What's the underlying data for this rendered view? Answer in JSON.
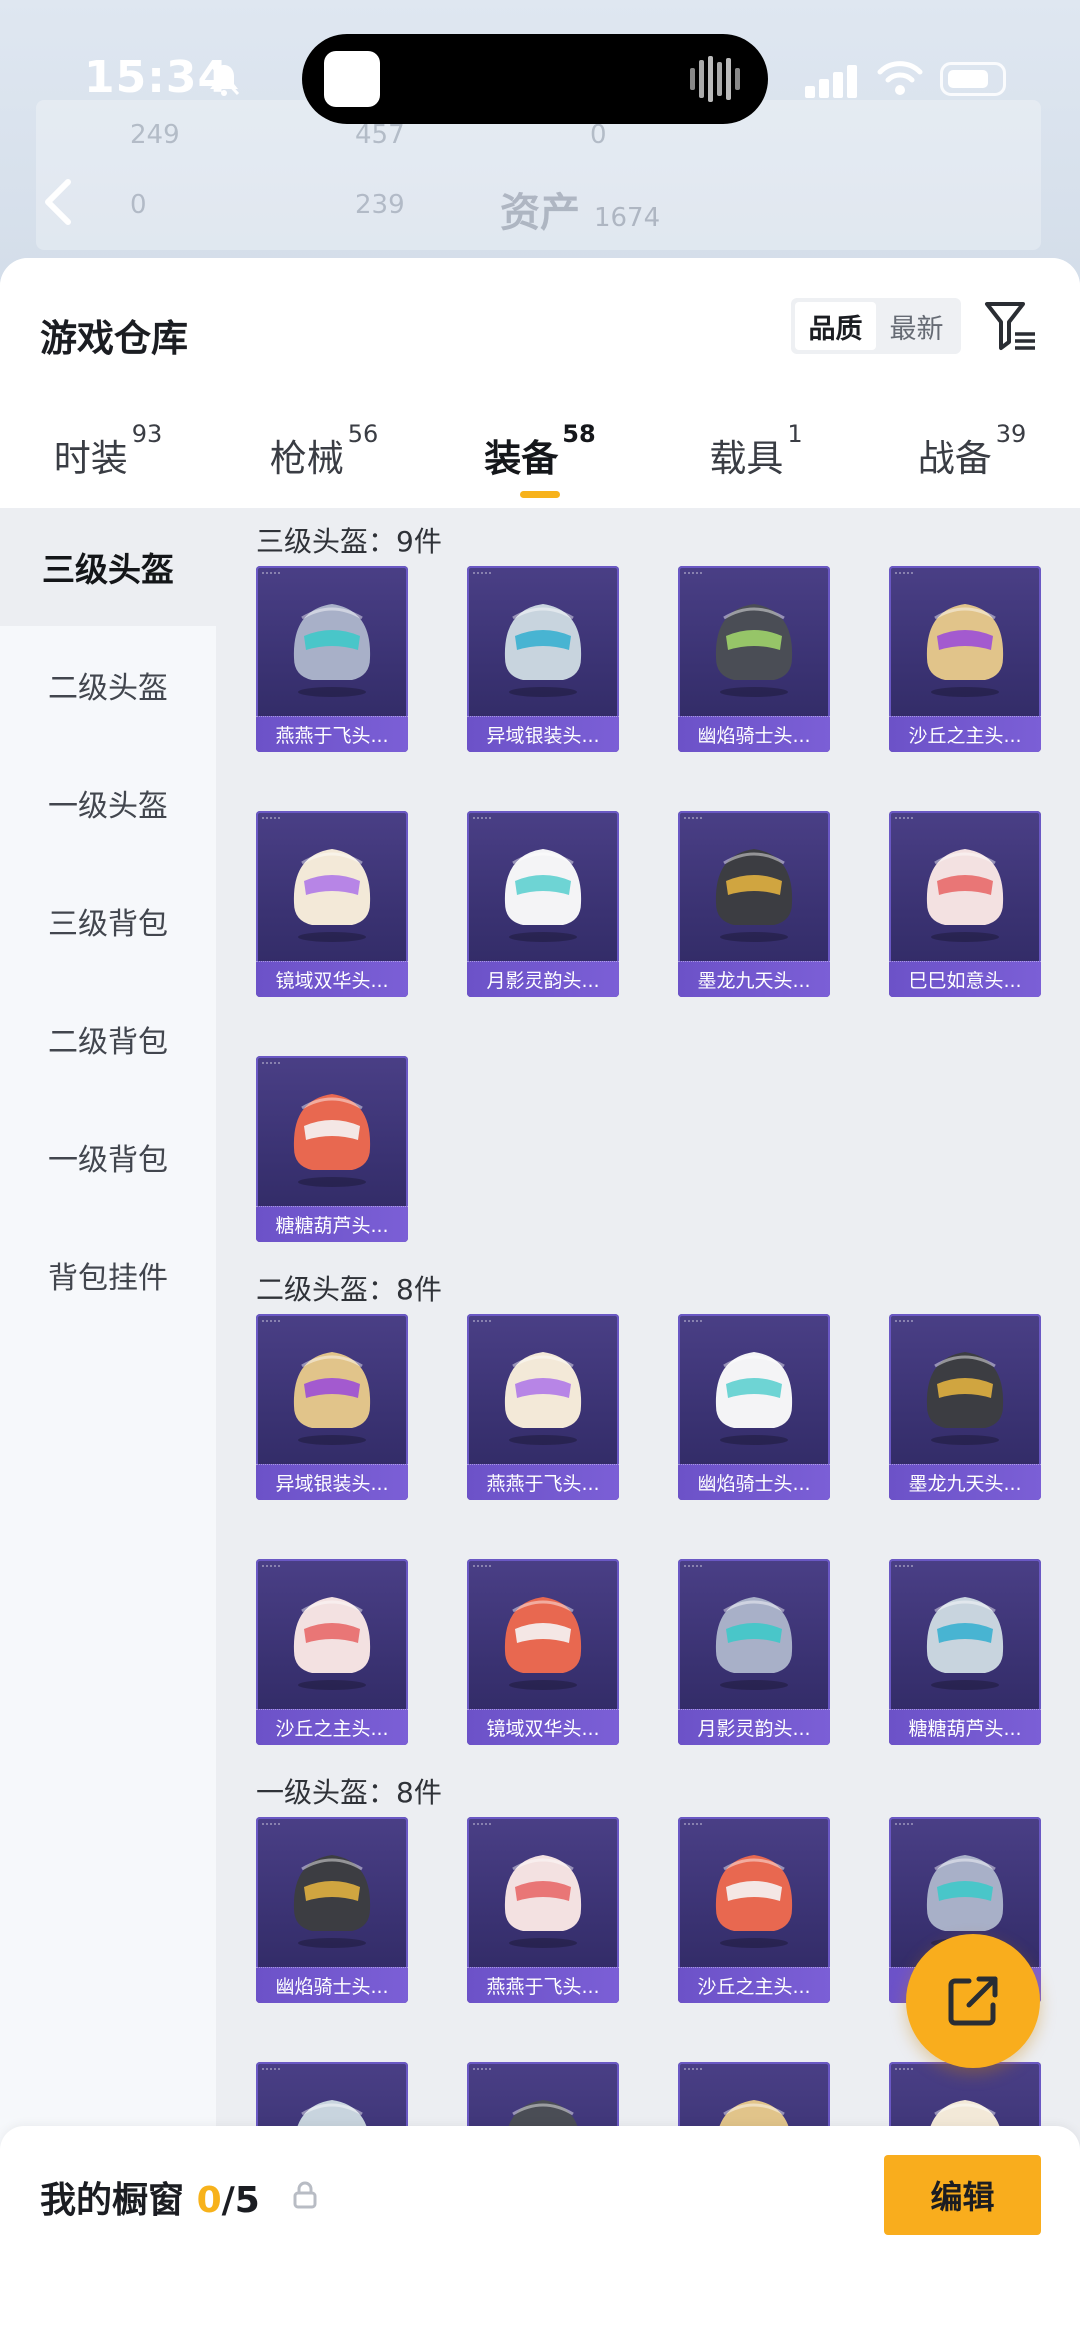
{
  "status_bar": {
    "time": "15:34"
  },
  "backdrop": {
    "nums": [
      "249",
      "457",
      "0",
      "0",
      "239",
      "1674"
    ],
    "asset_label": "资产"
  },
  "header": {
    "title": "游戏仓库",
    "sort_options": [
      "品质",
      "最新"
    ],
    "active_sort": "品质"
  },
  "tabs": [
    {
      "label": "时装",
      "count": "93"
    },
    {
      "label": "枪械",
      "count": "56"
    },
    {
      "label": "装备",
      "count": "58",
      "active": true
    },
    {
      "label": "载具",
      "count": "1"
    },
    {
      "label": "战备",
      "count": "39"
    }
  ],
  "sidebar": [
    {
      "label": "三级头盔",
      "active": true
    },
    {
      "label": "二级头盔"
    },
    {
      "label": "一级头盔"
    },
    {
      "label": "三级背包"
    },
    {
      "label": "二级背包"
    },
    {
      "label": "一级背包"
    },
    {
      "label": "背包挂件"
    }
  ],
  "sections": [
    {
      "title": "三级头盔：9件",
      "items": [
        "燕燕于飞头...",
        "异域银装头...",
        "幽焰骑士头...",
        "沙丘之主头...",
        "镜域双华头...",
        "月影灵韵头...",
        "墨龙九天头...",
        "巳巳如意头...",
        "糖糖葫芦头..."
      ]
    },
    {
      "title": "二级头盔：8件",
      "items": [
        "异域银装头...",
        "燕燕于飞头...",
        "幽焰骑士头...",
        "墨龙九天头...",
        "沙丘之主头...",
        "镜域双华头...",
        "月影灵韵头...",
        "糖糖葫芦头..."
      ]
    },
    {
      "title": "一级头盔：8件",
      "items": [
        "幽焰骑士头...",
        "燕燕于飞头...",
        "沙丘之主头...",
        "",
        "",
        "",
        "",
        ""
      ]
    }
  ],
  "showcase": {
    "label": "我的橱窗",
    "count": "0",
    "total": "/5"
  },
  "edit_button": "编辑",
  "colors": {
    "accent": "#f9ad1d",
    "card_bg": "#3a3272",
    "card_label": "#7b5fd6"
  }
}
